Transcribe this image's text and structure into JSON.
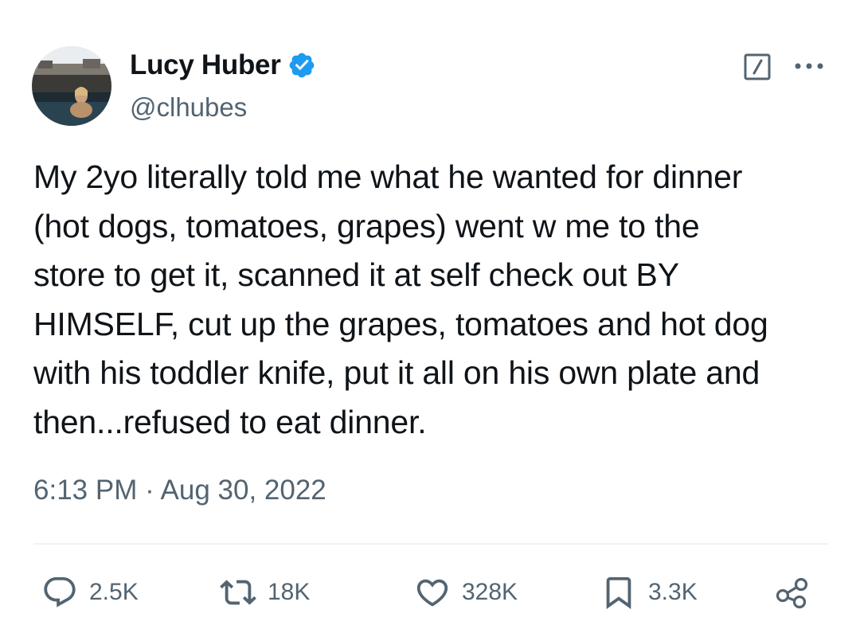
{
  "author": {
    "display_name": "Lucy Huber",
    "handle": "@clhubes",
    "verified": true,
    "verified_color": "#1d9bf0"
  },
  "tweet": {
    "text": "My 2yo literally told me what he wanted for dinner\n(hot dogs, tomatoes, grapes) went w me to the\nstore to get it, scanned it at self check out BY\nHIMSELF, cut up the grapes, tomatoes and hot dog\nwith his toddler knife, put it all on his own plate and\nthen...refused to eat dinner.",
    "timestamp": "6:13 PM · Aug 30, 2022"
  },
  "actions": {
    "replies": "2.5K",
    "retweets": "18K",
    "likes": "328K",
    "bookmarks": "3.3K"
  },
  "icons": {
    "header": [
      "grok-icon",
      "more-icon"
    ],
    "actions": [
      "reply-icon",
      "retweet-icon",
      "like-icon",
      "bookmark-icon",
      "share-icon"
    ]
  },
  "colors": {
    "text_primary": "#0f1419",
    "text_secondary": "#536471",
    "divider": "#eff3f4",
    "accent": "#1d9bf0"
  }
}
